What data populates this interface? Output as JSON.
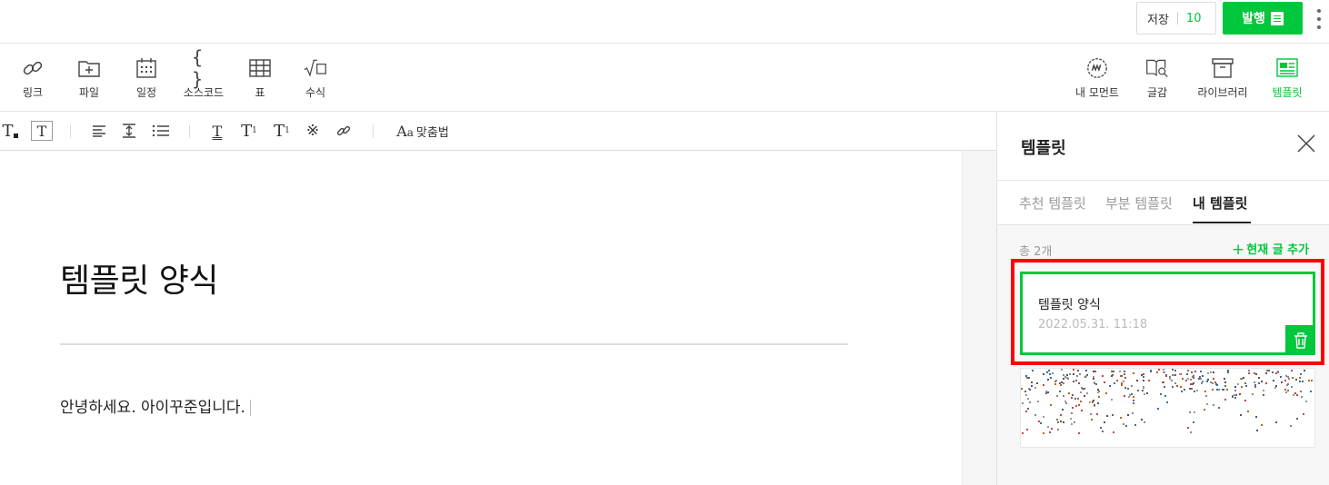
{
  "topbar": {
    "save_label": "저장",
    "save_count": "10",
    "publish_label": "발행"
  },
  "insert_toolbar": {
    "left": [
      {
        "label": "링크",
        "icon": "link-icon"
      },
      {
        "label": "파일",
        "icon": "folder-plus-icon"
      },
      {
        "label": "일정",
        "icon": "calendar-icon"
      },
      {
        "label": "소스코드",
        "icon": "braces-icon"
      },
      {
        "label": "표",
        "icon": "table-icon"
      },
      {
        "label": "수식",
        "icon": "sqrt-icon"
      }
    ],
    "right": [
      {
        "label": "내 모먼트",
        "icon": "moment-icon"
      },
      {
        "label": "글감",
        "icon": "book-search-icon"
      },
      {
        "label": "라이브러리",
        "icon": "archive-icon"
      },
      {
        "label": "템플릿",
        "icon": "template-icon",
        "active": true
      }
    ]
  },
  "format_toolbar": {
    "spellcheck_label": "맞춤법"
  },
  "document": {
    "title": "템플릿 양식",
    "body": "안녕하세요. 아이꾸준입니다."
  },
  "template_panel": {
    "title": "템플릿",
    "tabs": [
      "추천 템플릿",
      "부분 템플릿",
      "내 템플릿"
    ],
    "active_tab": "내 템플릿",
    "count_label": "총 2개",
    "add_current_label": "현재 글 추가",
    "items": [
      {
        "title": "템플릿 양식",
        "date": "2022.05.31. 11:18"
      }
    ]
  },
  "colors": {
    "accent": "#00c73c",
    "highlight": "#ff0000"
  }
}
